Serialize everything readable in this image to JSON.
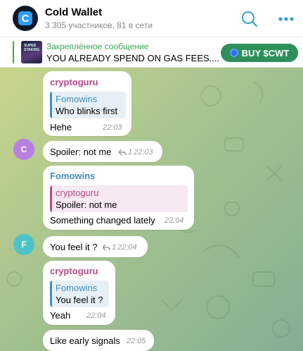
{
  "header": {
    "title": "Cold Wallet",
    "subtitle": "3 305 участников, 81 в сети",
    "avatar_letter": "C"
  },
  "pinned": {
    "title": "Закреплённое сообщение",
    "text": "YOU ALREADY SPEND ON GAS FEES....",
    "button": "BUY $CWT",
    "thumb_text": "SUPER STAKING"
  },
  "colors": {
    "pinned_accent": "#3aa757",
    "buy_button": "#2f8f5b",
    "cryptoguru": "#b94a8c",
    "fomowins": "#3f8fc2",
    "avatar_c": "#b77fe0",
    "avatar_f": "#4cc3c8"
  },
  "messages": [
    {
      "sender": "cryptoguru",
      "reply_to": {
        "name": "Fomowins",
        "text": "Who blinks first"
      },
      "text": "Hehe",
      "time": "22:03"
    },
    {
      "avatar": "C",
      "text": "Spoiler: not me",
      "reply_count": "1",
      "time": "22:03"
    },
    {
      "sender": "Fomowins",
      "reply_to": {
        "name": "cryptoguru",
        "text": "Spoiler: not me"
      },
      "text": "Something changed lately",
      "time": "22:04"
    },
    {
      "avatar": "F",
      "text": "You feel it ?",
      "reply_count": "1",
      "time": "22:04"
    },
    {
      "sender": "cryptoguru",
      "reply_to": {
        "name": "Fomowins",
        "text": "You feel it ?"
      },
      "text": "Yeah",
      "time": "22:04"
    },
    {
      "text": "Like early signals",
      "time": "22:05"
    }
  ]
}
